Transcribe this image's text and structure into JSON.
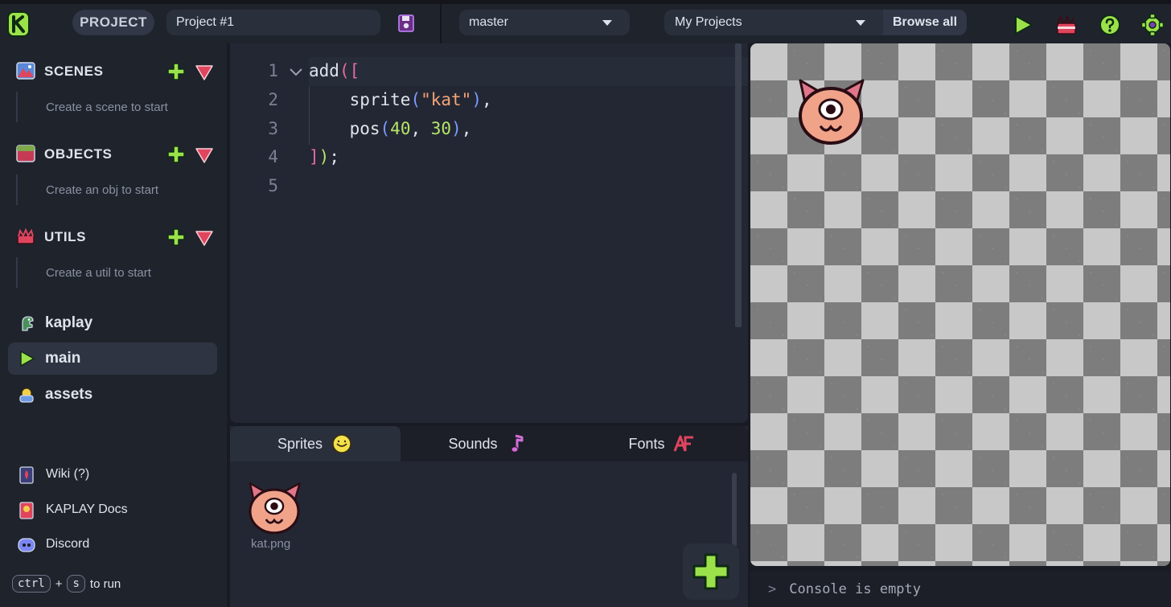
{
  "topbar": {
    "project_label": "PROJECT",
    "project_name": "Project #1",
    "branch": "master",
    "projects_select": "My Projects",
    "browse_all": "Browse all"
  },
  "sidebar": {
    "sections": [
      {
        "title": "SCENES",
        "empty": "Create a scene to start"
      },
      {
        "title": "OBJECTS",
        "empty": "Create an obj to start"
      },
      {
        "title": "UTILS",
        "empty": "Create a util to start"
      }
    ],
    "files": [
      {
        "label": "kaplay"
      },
      {
        "label": "main",
        "active": true
      },
      {
        "label": "assets"
      }
    ],
    "links": [
      {
        "label": "Wiki (?)"
      },
      {
        "label": "KAPLAY Docs"
      },
      {
        "label": "Discord"
      }
    ],
    "hint": {
      "key1": "ctrl",
      "plus": "+",
      "key2": "s",
      "suffix": "to run"
    }
  },
  "editor": {
    "line_numbers": [
      "1",
      "2",
      "3",
      "4",
      "5"
    ],
    "code": {
      "l1_fn": "add",
      "l1_p": "(",
      "l1_b": "[",
      "l2_fn": "    sprite",
      "l2_p1": "(",
      "l2_str": "\"kat\"",
      "l2_p2": ")",
      "l2_end": ",",
      "l3_fn": "    pos",
      "l3_p1": "(",
      "l3_n1": "40",
      "l3_sep": ", ",
      "l3_n2": "30",
      "l3_p2": ")",
      "l3_end": ",",
      "l4_b": "]",
      "l4_p": ")",
      "l4_end": ";"
    }
  },
  "assets": {
    "tabs": [
      {
        "label": "Sprites",
        "active": true
      },
      {
        "label": "Sounds"
      },
      {
        "label": "Fonts"
      }
    ],
    "items": [
      {
        "name": "kat.png"
      }
    ]
  },
  "console": {
    "prompt": ">",
    "text": "Console is empty"
  },
  "colors": {
    "accent_green": "#9be24a",
    "danger_red": "#e0455e",
    "kat_pink": "#f1a38a",
    "bg_dark": "#181b24"
  }
}
